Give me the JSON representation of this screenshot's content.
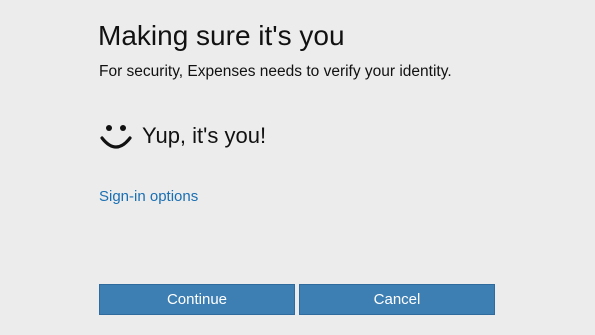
{
  "dialog": {
    "title": "Making sure it's you",
    "subtitle": "For security, Expenses needs to verify your identity.",
    "status": {
      "icon": "smiley-face-icon",
      "text": "Yup, it's you!"
    },
    "sign_in_options_label": "Sign-in options",
    "buttons": {
      "continue_label": "Continue",
      "cancel_label": "Cancel"
    }
  },
  "colors": {
    "background": "#ececec",
    "link": "#1a6fb3",
    "button_fill": "#3e7fb3",
    "text": "#111111"
  }
}
